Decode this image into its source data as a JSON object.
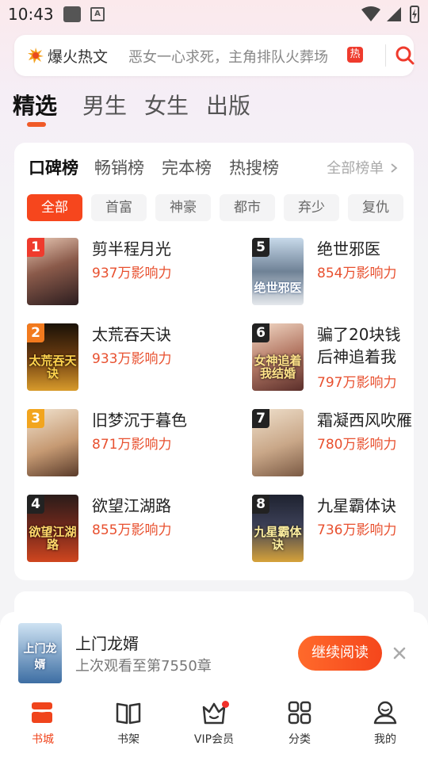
{
  "status_bar": {
    "time": "10:43",
    "notif_letter": "A"
  },
  "search": {
    "hot_label": "爆火热文",
    "query": "恶女一心求死，主角排队火葬场",
    "badge": "热"
  },
  "channels": [
    "精选",
    "男生",
    "女生",
    "出版"
  ],
  "ranking": {
    "tabs": [
      "口碑榜",
      "畅销榜",
      "完本榜",
      "热搜榜"
    ],
    "all_list": "全部榜单",
    "chips": [
      "全部",
      "首富",
      "神豪",
      "都市",
      "弃少",
      "复仇"
    ],
    "books": [
      {
        "rank": "1",
        "title": "剪半程月光",
        "metric": "937万影响力",
        "cover_text": ""
      },
      {
        "rank": "2",
        "title": "太荒吞天诀",
        "metric": "933万影响力",
        "cover_text": "太荒吞天诀"
      },
      {
        "rank": "3",
        "title": "旧梦沉于暮色",
        "metric": "871万影响力",
        "cover_text": ""
      },
      {
        "rank": "4",
        "title": "欲望江湖路",
        "metric": "855万影响力",
        "cover_text": "欲望江湖路"
      },
      {
        "rank": "5",
        "title": "绝世邪医",
        "metric": "854万影响力",
        "cover_text": "绝世邪医"
      },
      {
        "rank": "6",
        "title": "骗了20块钱后神追着我结婚",
        "metric": "797万影响力",
        "cover_text": "女神追着我结婚"
      },
      {
        "rank": "7",
        "title": "霜凝西风吹雁",
        "metric": "780万影响力",
        "cover_text": ""
      },
      {
        "rank": "8",
        "title": "九星霸体诀",
        "metric": "736万影响力",
        "cover_text": "九星霸体诀"
      }
    ]
  },
  "continue_reading": {
    "title": "上门龙婿",
    "subtitle": "上次观看至第7550章",
    "button": "继续阅读",
    "cover_text": "上门龙婿"
  },
  "bottom_nav": [
    "书城",
    "书架",
    "VIP会员",
    "分类",
    "我的"
  ],
  "colors": {
    "accent": "#f5461c",
    "metric": "#e8502f"
  }
}
